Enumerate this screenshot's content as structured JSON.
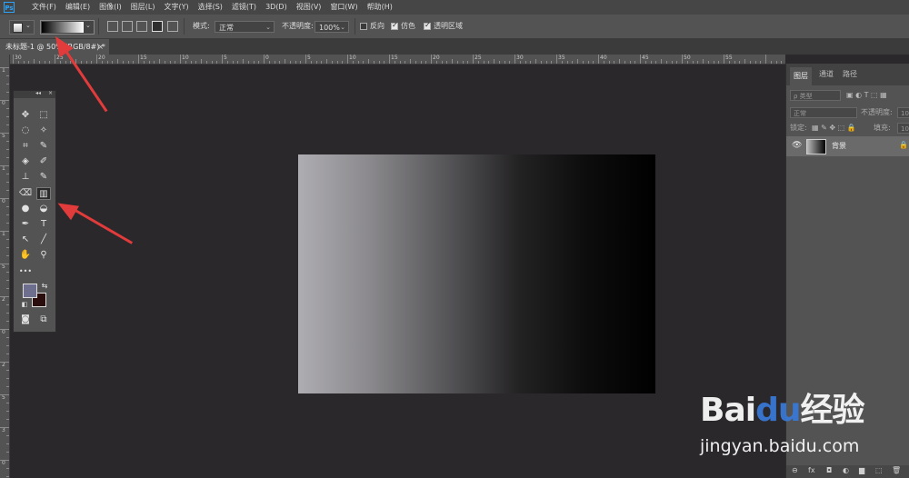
{
  "app": {
    "logo": "Ps"
  },
  "menu": [
    "文件(F)",
    "编辑(E)",
    "图像(I)",
    "图层(L)",
    "文字(Y)",
    "选择(S)",
    "滤镜(T)",
    "3D(D)",
    "视图(V)",
    "窗口(W)",
    "帮助(H)"
  ],
  "options": {
    "mode_label": "模式:",
    "mode_value": "正常",
    "opacity_label": "不透明度:",
    "opacity_value": "100%",
    "reverse_label": "反向",
    "dither_label": "仿色",
    "transparency_label": "透明区域",
    "reverse_checked": false,
    "dither_checked": true,
    "transparency_checked": true
  },
  "document": {
    "tab_title": "未标题-1 @ 50% (RGB/8#) *",
    "close": "×"
  },
  "rulers": {
    "h_labels": [
      "30",
      "25",
      "20",
      "15",
      "10",
      "5",
      "0",
      "5",
      "10",
      "15",
      "20",
      "25",
      "30",
      "35",
      "40",
      "45",
      "50",
      "55"
    ],
    "v_labels": [
      "1",
      "0",
      "5",
      "1",
      "0",
      "1",
      "5",
      "2",
      "0",
      "2",
      "5",
      "3",
      "0"
    ]
  },
  "toolbox": {
    "collapse": "◂◂",
    "close": "×",
    "tools": [
      [
        "✥",
        "⬚"
      ],
      [
        "◌",
        "✧"
      ],
      [
        "⌗",
        "✎"
      ],
      [
        "◈",
        "✐"
      ],
      [
        "⊥",
        "✎"
      ],
      [
        "⌫",
        "▥"
      ],
      [
        "●",
        "◒"
      ],
      [
        "✒",
        "T"
      ],
      [
        "↖",
        "╱"
      ],
      [
        "✋",
        "⚲"
      ]
    ],
    "more": "•••",
    "selected_tool": "gradient-tool",
    "fg_color": "#6e6f8e",
    "bg_color": "#2a0d0d"
  },
  "layers_panel": {
    "tabs": [
      "图层",
      "通道",
      "路径"
    ],
    "filter_label": "ρ 类型",
    "blend_mode": "正常",
    "opacity_label": "不透明度:",
    "opacity_value": "100",
    "lock_label": "锁定:",
    "fill_label": "填充:",
    "fill_value": "100",
    "layer_name": "背景",
    "footer_icons": [
      "⊖",
      "fx",
      "◘",
      "◐",
      "▆",
      "⬚",
      "🗑"
    ]
  },
  "watermark": {
    "brand_prefix": "Bai",
    "brand_du": "du",
    "brand_suffix": "经验",
    "url": "jingyan.baidu.com"
  }
}
